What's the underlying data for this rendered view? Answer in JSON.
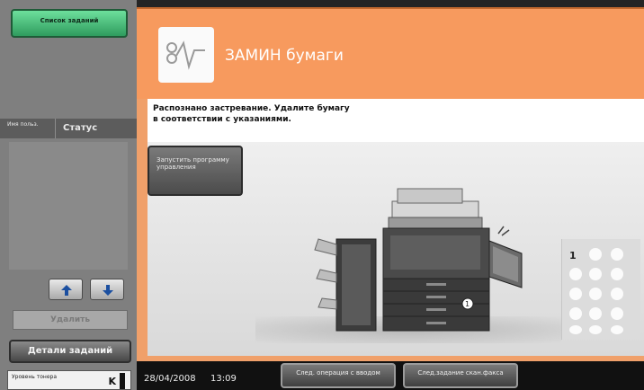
{
  "left_panel": {
    "job_list_button": "Список заданий",
    "user_tab": "Имя польз.",
    "status_tab": "Статус",
    "delete_button": "Удалить",
    "job_details_button": "Детали заданий",
    "toner_label": "Уровень тонера",
    "toner_color": "K"
  },
  "screen": {
    "title": "ЗАМИН бумаги",
    "message_line1": "Распознано застревание. Удалите бумагу",
    "message_line2": "в соответствии с указаниями.",
    "launch_guide_button": "Запустить программу управления",
    "step_number": "1"
  },
  "bottom_bar": {
    "date": "28/04/2008",
    "time": "13:09",
    "next_operation_button": "След. операция с вводом",
    "next_scan_button": "След.задание скан.факса"
  },
  "colors": {
    "accent_orange": "#f79a5e",
    "job_list_green": "#2f9c5e",
    "panel_gray": "#7f7f7f"
  },
  "icons": {
    "logo": "wave-logo-icon",
    "up": "arrow-up-icon",
    "down": "arrow-down-icon"
  }
}
